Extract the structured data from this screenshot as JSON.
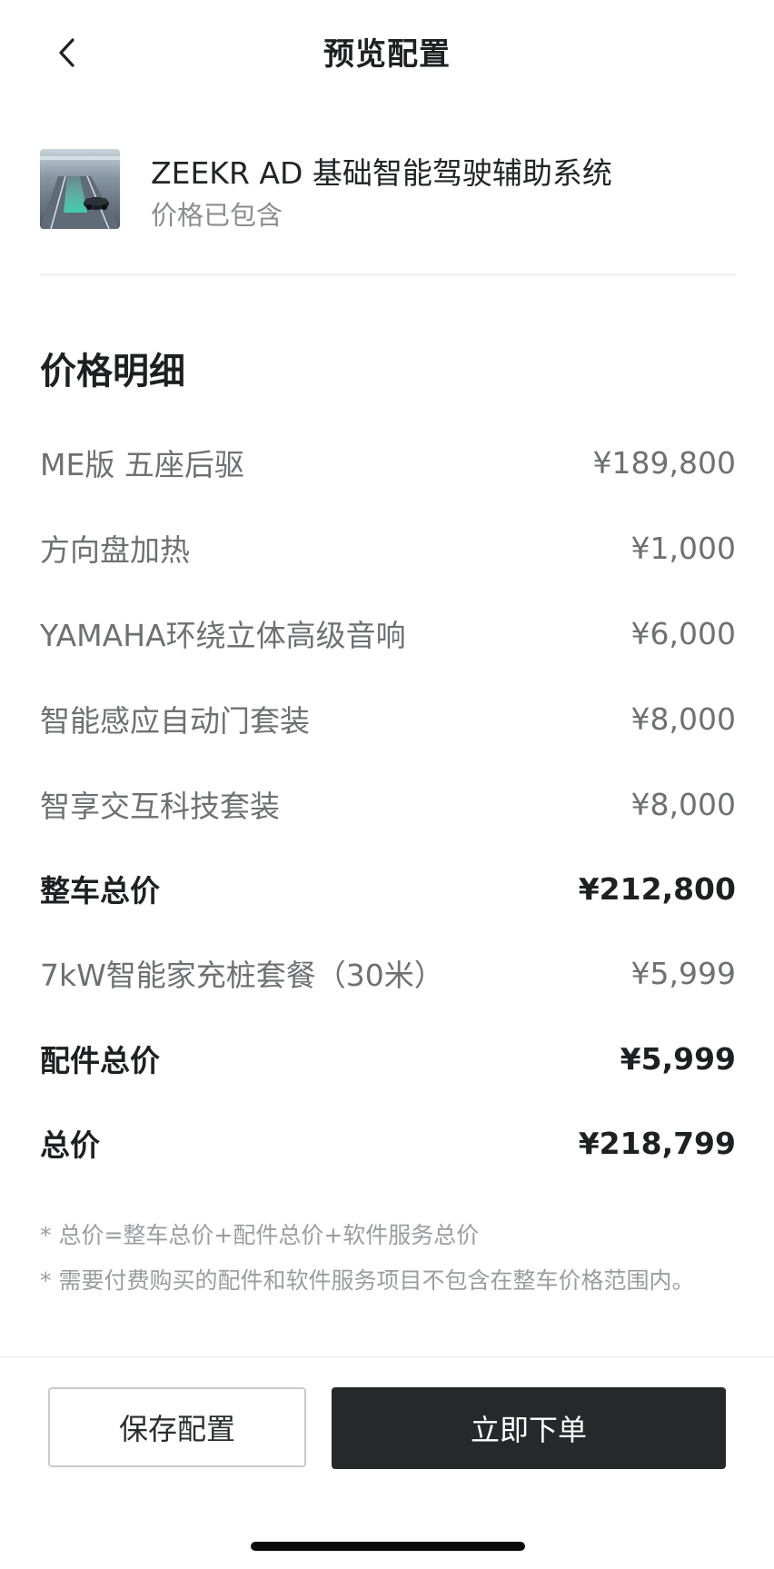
{
  "header": {
    "title": "预览配置",
    "back_icon": "chevron-left-icon"
  },
  "feature": {
    "title": "ZEEKR AD 基础智能驾驶辅助系统",
    "subtitle": "价格已包含"
  },
  "price_detail": {
    "title": "价格明细",
    "items": [
      {
        "label": "ME版 五座后驱",
        "amount": "¥189,800"
      },
      {
        "label": "方向盘加热",
        "amount": "¥1,000"
      },
      {
        "label": "YAMAHA环绕立体高级音响",
        "amount": "¥6,000"
      },
      {
        "label": "智能感应自动门套装",
        "amount": "¥8,000"
      },
      {
        "label": "智享交互科技套装",
        "amount": "¥8,000"
      }
    ],
    "vehicle_total": {
      "label": "整车总价",
      "amount": "¥212,800"
    },
    "accessory": {
      "label": "7kW智能家充桩套餐（30米）",
      "amount": "¥5,999"
    },
    "accessory_total": {
      "label": "配件总价",
      "amount": "¥5,999"
    },
    "grand_total": {
      "label": "总价",
      "amount": "¥218,799"
    }
  },
  "notes": [
    "* 总价=整车总价+配件总价+软件服务总价",
    "* 需要付费购买的配件和软件服务项目不包含在整车价格范围内。"
  ],
  "actions": {
    "save_label": "保存配置",
    "order_label": "立即下单"
  }
}
